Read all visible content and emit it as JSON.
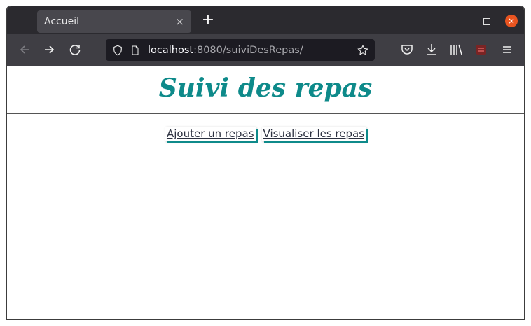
{
  "browser": {
    "tab": {
      "title": "Accueil",
      "close_label": "×"
    },
    "new_tab_label": "+",
    "window_controls": {
      "minimize": "–",
      "close": "×"
    },
    "url": {
      "host": "localhost",
      "rest": ":8080/suiviDesRepas/"
    }
  },
  "page": {
    "title": "Suivi des repas",
    "nav": [
      {
        "label": "Ajouter un repas"
      },
      {
        "label": "Visualiser les repas"
      }
    ]
  },
  "colors": {
    "accent": "#0e8a8a",
    "titlebar": "#2b2a2f",
    "toolbar": "#3f3e44",
    "urlbar": "#1c1b22",
    "close": "#e95420"
  }
}
